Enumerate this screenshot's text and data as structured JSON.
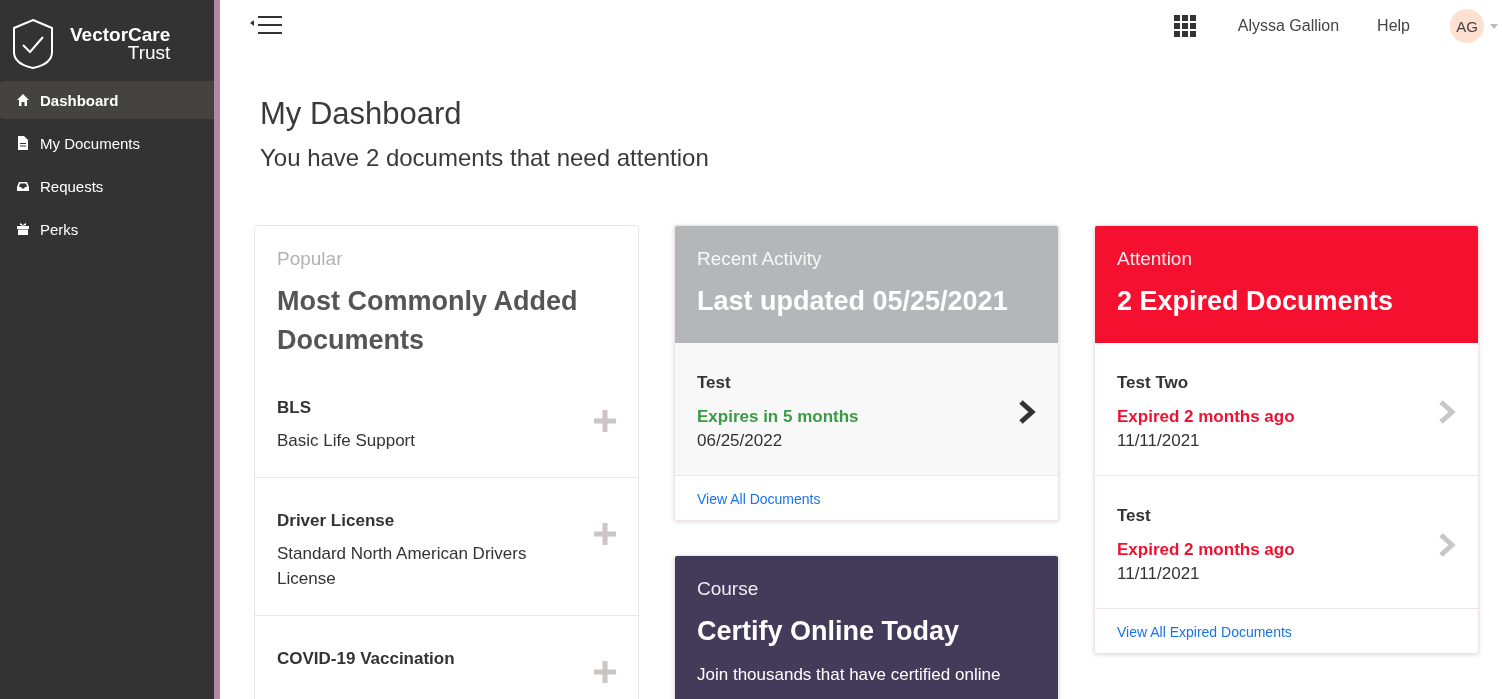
{
  "brand": {
    "name": "VectorCare",
    "sub": "Trust"
  },
  "sidebar": {
    "items": [
      {
        "label": "Dashboard",
        "kind": "home",
        "selected": true
      },
      {
        "label": "My Documents",
        "kind": "file",
        "selected": false
      },
      {
        "label": "Requests",
        "kind": "inbox",
        "selected": false
      },
      {
        "label": "Perks",
        "kind": "gift",
        "selected": false
      }
    ]
  },
  "topbar": {
    "user": "Alyssa Gallion",
    "help": "Help",
    "avatar": "AG"
  },
  "page": {
    "title": "My Dashboard",
    "subtitle": "You have 2 documents that need attention"
  },
  "columns": [
    [
      {
        "kind": "popular",
        "label": "Popular",
        "title": "Most Commonly Added Documents",
        "items": [
          {
            "name": "BLS",
            "description": "Basic Life Support"
          },
          {
            "name": "Driver License",
            "description": "Standard North American Drivers License"
          },
          {
            "name": "COVID-19 Vaccination"
          }
        ]
      }
    ],
    [
      {
        "kind": "activity",
        "label": "Recent Activity",
        "title": "Last updated 05/25/2021",
        "docs": [
          {
            "name": "Test",
            "kind": "valid",
            "status": "Expires in 5 months",
            "date": "06/25/2022"
          }
        ],
        "link": "View All Documents"
      },
      {
        "kind": "course",
        "label": "Course",
        "title": "Certify Online Today",
        "text": "Join thousands that have certified online"
      }
    ],
    [
      {
        "kind": "attention",
        "label": "Attention",
        "title": "2 Expired Documents",
        "docs": [
          {
            "name": "Test Two",
            "kind": "expired",
            "status": "Expired 2 months ago",
            "date": "11/11/2021"
          },
          {
            "name": "Test",
            "kind": "expired",
            "status": "Expired 2 months ago",
            "date": "11/11/2021"
          }
        ],
        "link": "View All Expired Documents"
      }
    ]
  ]
}
